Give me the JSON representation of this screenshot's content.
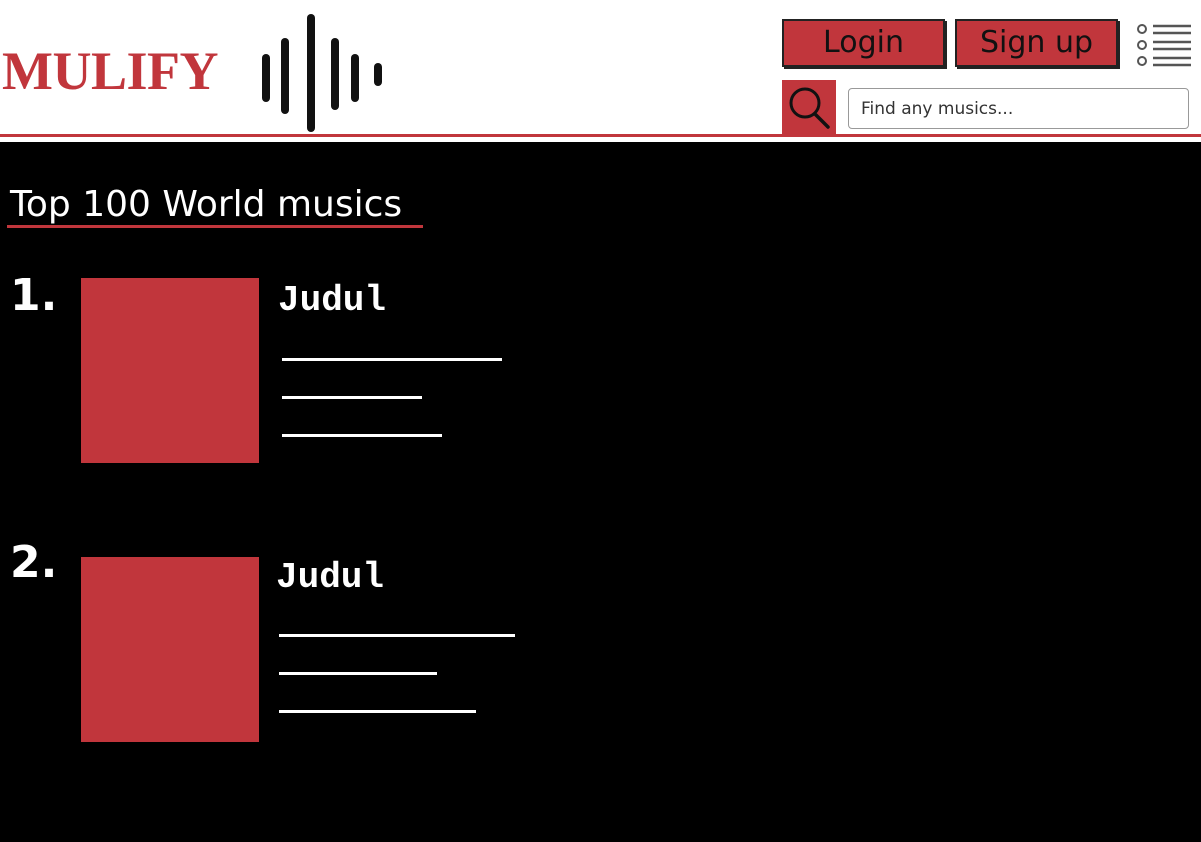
{
  "header": {
    "logo_text": "MULIFY",
    "login_label": "Login",
    "signup_label": "Sign up",
    "search_placeholder": "Find any musics...",
    "brand_color": "#c1363c"
  },
  "main": {
    "section_title": "Top 100 World musics",
    "items": [
      {
        "rank": "1.",
        "title": "Judul"
      },
      {
        "rank": "2.",
        "title": "Judul"
      }
    ]
  },
  "icons": {
    "logo": "sound-wave-icon",
    "menu": "list-menu-icon",
    "search": "magnifier-icon"
  }
}
